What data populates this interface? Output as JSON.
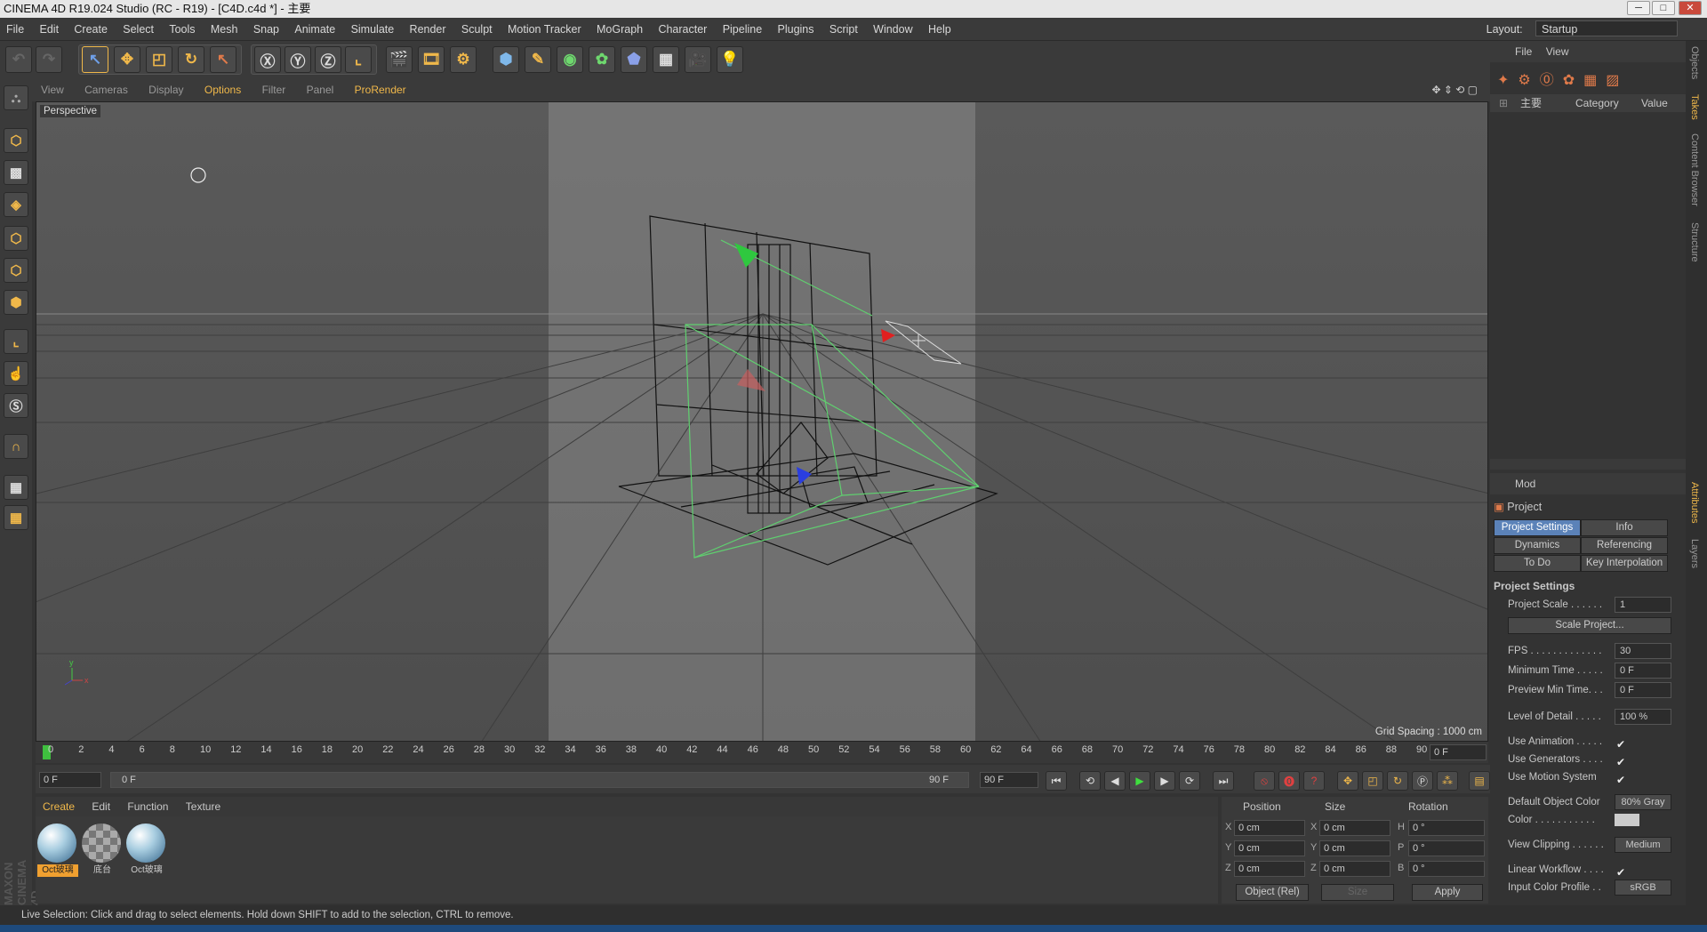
{
  "window": {
    "title": "CINEMA 4D R19.024 Studio (RC - R19) - [C4D.c4d *] - 主要",
    "minimize": "─",
    "maximize": "□",
    "close": "✕"
  },
  "menu": [
    "File",
    "Edit",
    "Create",
    "Select",
    "Tools",
    "Mesh",
    "Snap",
    "Animate",
    "Simulate",
    "Render",
    "Sculpt",
    "Motion Tracker",
    "MoGraph",
    "Character",
    "Pipeline",
    "Plugins",
    "Script",
    "Window",
    "Help"
  ],
  "layout": {
    "label": "Layout:",
    "value": "Startup"
  },
  "viewport": {
    "menu": [
      "View",
      "Cameras",
      "Display",
      "Options",
      "Filter",
      "Panel",
      "ProRender"
    ],
    "name": "Perspective",
    "grid_spacing": "Grid Spacing : 1000 cm"
  },
  "timeline": {
    "ticks": [
      "0",
      "2",
      "4",
      "6",
      "8",
      "10",
      "12",
      "14",
      "16",
      "18",
      "20",
      "22",
      "24",
      "26",
      "28",
      "30",
      "32",
      "34",
      "36",
      "38",
      "40",
      "42",
      "44",
      "46",
      "48",
      "50",
      "52",
      "54",
      "56",
      "58",
      "60",
      "62",
      "64",
      "66",
      "68",
      "70",
      "72",
      "74",
      "76",
      "78",
      "80",
      "82",
      "84",
      "86",
      "88",
      "90"
    ],
    "current_frame": "0 F",
    "start": "0 F",
    "range_start": "0 F",
    "range_end": "90 F",
    "end": "90 F"
  },
  "material": {
    "tabs": [
      "Create",
      "Edit",
      "Function",
      "Texture"
    ],
    "items": [
      "Oct玻璃",
      "底台",
      "Oct玻璃"
    ]
  },
  "coords": {
    "headers": [
      "Position",
      "Size",
      "Rotation"
    ],
    "pos": [
      {
        "axis": "X",
        "val": "0 cm"
      },
      {
        "axis": "Y",
        "val": "0 cm"
      },
      {
        "axis": "Z",
        "val": "0 cm"
      }
    ],
    "size": [
      {
        "axis": "X",
        "val": "0 cm"
      },
      {
        "axis": "Y",
        "val": "0 cm"
      },
      {
        "axis": "Z",
        "val": "0 cm"
      }
    ],
    "rot": [
      {
        "axis": "H",
        "val": "0 °"
      },
      {
        "axis": "P",
        "val": "0 °"
      },
      {
        "axis": "B",
        "val": "0 °"
      }
    ],
    "mode": "Object (Rel)",
    "size_mode": "Size",
    "apply": "Apply"
  },
  "objects": {
    "menu": [
      "File",
      "View"
    ],
    "take": "主要",
    "col_category": "Category",
    "col_value": "Value"
  },
  "attributes": {
    "mode": "Mod",
    "title": "Project",
    "tabs": [
      "Project Settings",
      "Info",
      "Dynamics",
      "Referencing",
      "To Do",
      "Key Interpolation"
    ],
    "section": "Project Settings",
    "project_scale_label": "Project Scale . . . . . .",
    "project_scale": "1",
    "scale_project": "Scale Project...",
    "fps_label": "FPS . . . . . . . . . . . . .",
    "fps": "30",
    "min_time_label": "Minimum Time . . . . .",
    "min_time": "0 F",
    "preview_min_label": "Preview Min Time. . .",
    "preview_min": "0 F",
    "lod_label": "Level of Detail . . . . .",
    "lod": "100 %",
    "use_anim_label": "Use Animation . . . . .",
    "use_gen_label": "Use Generators . . . .",
    "use_motion_label": "Use Motion System",
    "default_color_label": "Default Object Color",
    "default_color": "80% Gray",
    "color_label": "Color . . . . . . . . . . .",
    "view_clip_label": "View Clipping . . . . . .",
    "view_clip": "Medium",
    "linear_label": "Linear Workflow . . . .",
    "input_profile_label": "Input Color Profile . .",
    "input_profile": "sRGB",
    "check": "✔"
  },
  "side_tabs": [
    "Objects",
    "Takes",
    "Content Browser",
    "Structure",
    "Attributes",
    "Layers"
  ],
  "status": "Live Selection: Click and drag to select elements. Hold down SHIFT to add to the selection, CTRL to remove.",
  "brand": "MAXON CINEMA 4D",
  "colors": {
    "accent": "#f0b84a",
    "selected_tab": "#5b82b8",
    "viewport_bg": "#4f4f4f"
  }
}
